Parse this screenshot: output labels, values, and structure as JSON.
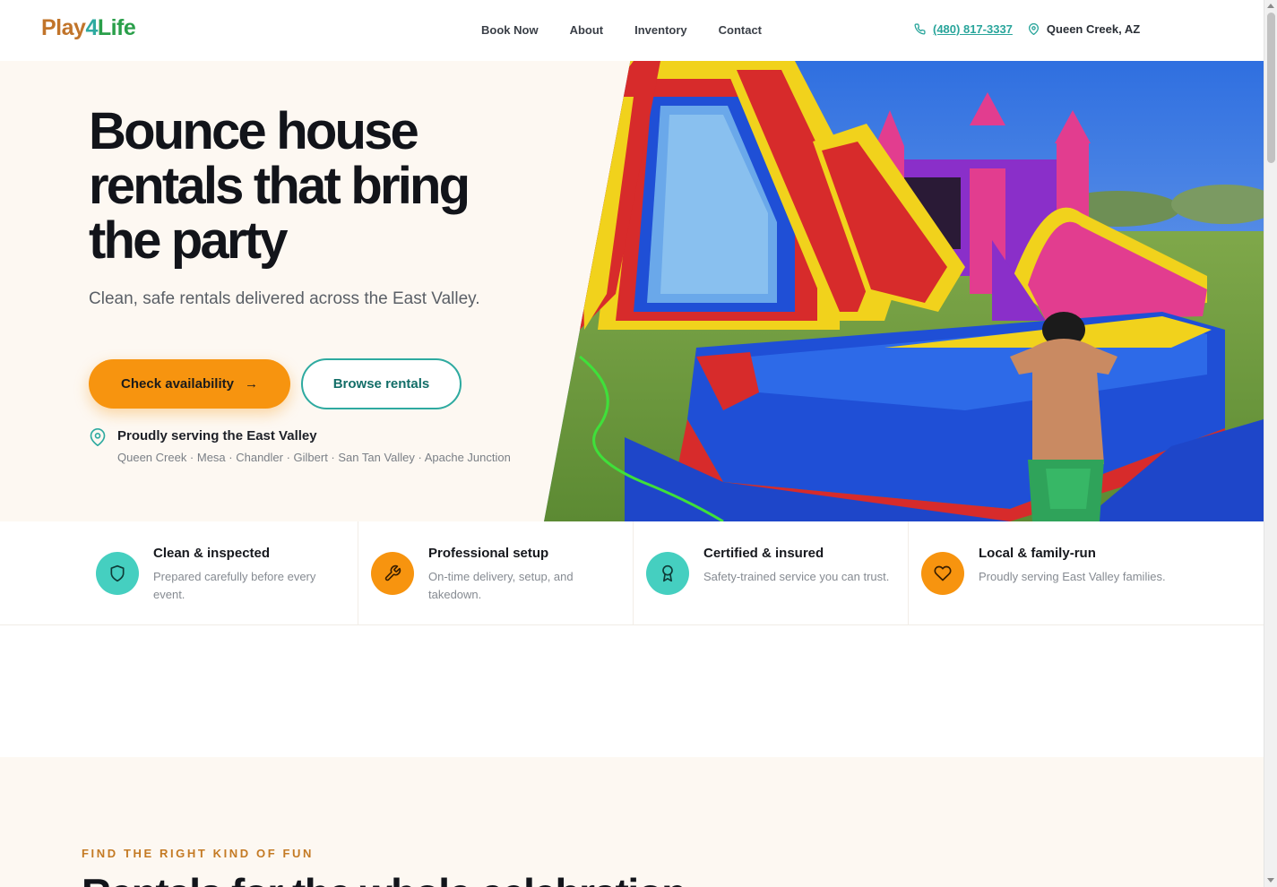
{
  "header": {
    "logo": {
      "part1": "Play",
      "part2": "4",
      "part3": "Life"
    },
    "nav": [
      {
        "label": "Book Now"
      },
      {
        "label": "About"
      },
      {
        "label": "Inventory"
      },
      {
        "label": "Contact"
      }
    ],
    "phone": "(480) 817-3337",
    "location": "Queen Creek, AZ"
  },
  "hero": {
    "title": "Bounce house rentals that bring the party",
    "subtitle": "Clean, safe rentals delivered across the East Valley.",
    "primary_cta": "Check availability",
    "primary_cta_icon": "→",
    "secondary_cta": "Browse rentals",
    "serving_title": "Proudly serving the East Valley",
    "serving_towns": "Queen Creek · Mesa · Chandler · Gilbert · San Tan Valley · Apache Junction"
  },
  "features": [
    {
      "icon": "shield-icon",
      "color": "#45cfc0",
      "title": "Clean & inspected",
      "desc": "Prepared carefully before every event."
    },
    {
      "icon": "wrench-icon",
      "color": "#f7940f",
      "title": "Professional setup",
      "desc": "On-time delivery, setup, and takedown."
    },
    {
      "icon": "award-icon",
      "color": "#45cfc0",
      "title": "Certified & insured",
      "desc": "Safety-trained service you can trust."
    },
    {
      "icon": "heart-icon",
      "color": "#f7940f",
      "title": "Local & family-run",
      "desc": "Proudly serving East Valley families."
    }
  ],
  "section2": {
    "eyebrow": "FIND THE RIGHT KIND OF FUN",
    "title": "Rentals for the whole celebration"
  },
  "colors": {
    "accent_orange": "#f7940f",
    "accent_teal": "#2eaaa0",
    "hero_bg": "#fdf8f2"
  }
}
